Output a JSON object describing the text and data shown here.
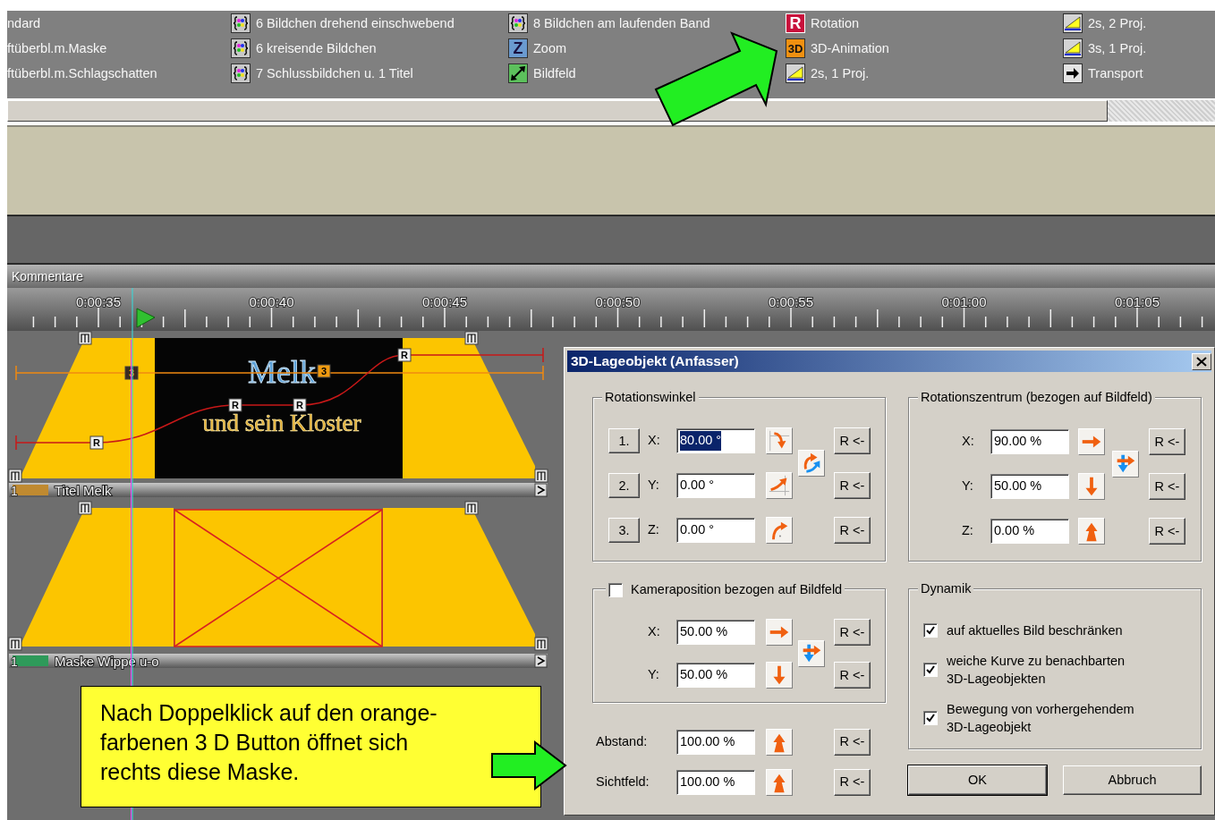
{
  "effects_panel": {
    "columns": [
      [
        {
          "label": "ndard",
          "kind": "none"
        },
        {
          "label": "ftüberbl.m.Maske",
          "kind": "none"
        },
        {
          "label": "ftüberbl.m.Schlagschatten",
          "kind": "none"
        }
      ],
      [
        {
          "label": "6 Bildchen drehend einschwebend",
          "kind": "star"
        },
        {
          "label": "6 kreisende Bildchen",
          "kind": "star"
        },
        {
          "label": "7 Schlussbildchen u. 1 Titel",
          "kind": "star"
        }
      ],
      [
        {
          "label": "8 Bildchen am laufenden Band",
          "kind": "star"
        },
        {
          "label": "Zoom",
          "kind": "zoom",
          "icon_text": "Z"
        },
        {
          "label": "Bildfeld",
          "kind": "field"
        }
      ],
      [
        {
          "label": "Rotation",
          "kind": "rotation",
          "icon_text": "R"
        },
        {
          "label": "3D-Animation",
          "kind": "animation",
          "icon_text": "3D"
        },
        {
          "label": "2s, 1 Proj.",
          "kind": "ramp"
        }
      ],
      [
        {
          "label": "2s, 2 Proj.",
          "kind": "ramp"
        },
        {
          "label": "3s, 1 Proj.",
          "kind": "ramp"
        },
        {
          "label": "Transport",
          "kind": "transport"
        }
      ]
    ]
  },
  "timeline": {
    "comments_label": "Kommentare",
    "time_labels": [
      "0:00:35",
      "0:00:40",
      "0:00:45",
      "0:00:50",
      "0:00:55",
      "0:01:00",
      "0:01:05"
    ],
    "tracks": [
      {
        "kind": "title",
        "number": "1",
        "name": "Titel Melk",
        "color": "#c08a30",
        "preview": {
          "line_1": "Melk",
          "line_2": "und sein Kloster"
        },
        "keyframes": [
          {
            "kind": "position",
            "label": "3",
            "selected": true
          },
          {
            "kind": "position",
            "label": "3",
            "selected": false
          },
          {
            "kind": "rotation",
            "label": "R",
            "selected": false
          },
          {
            "kind": "rotation",
            "label": "R",
            "selected": false
          },
          {
            "kind": "rotation",
            "label": "R",
            "selected": false
          },
          {
            "kind": "rotation",
            "label": "R",
            "selected": false
          }
        ]
      },
      {
        "kind": "mask",
        "number": "1",
        "name": "Maske Wippe u-o",
        "color": "#2e9a5a"
      }
    ]
  },
  "dialog": {
    "title": "3D-Lageobjekt (Anfasser)",
    "rotation": {
      "legend": "Rotationswinkel",
      "rows": [
        {
          "button": "1.",
          "axis": "X:",
          "value": "80.00 °",
          "text_selected": true,
          "reset": "R <-"
        },
        {
          "button": "2.",
          "axis": "Y:",
          "value": "0.00 °",
          "text_selected": false,
          "reset": "R <-"
        },
        {
          "button": "3.",
          "axis": "Z:",
          "value": "0.00 °",
          "text_selected": false,
          "reset": "R <-"
        }
      ]
    },
    "center": {
      "legend": "Rotationszentrum (bezogen auf Bildfeld)",
      "rows": [
        {
          "axis": "X:",
          "value": "90.00 %",
          "reset": "R <-"
        },
        {
          "axis": "Y:",
          "value": "50.00 %",
          "reset": "R <-"
        },
        {
          "axis": "Z:",
          "value": "0.00 %",
          "reset": "R <-"
        }
      ]
    },
    "camera": {
      "label": "Kameraposition bezogen auf Bildfeld",
      "checked": false,
      "rows": [
        {
          "axis": "X:",
          "value": "50.00 %",
          "reset": "R <-"
        },
        {
          "axis": "Y:",
          "value": "50.00 %",
          "reset": "R <-"
        }
      ]
    },
    "distance_rows": [
      {
        "label": "Abstand:",
        "value": "100.00 %",
        "reset": "R <-"
      },
      {
        "label": "Sichtfeld:",
        "value": "100.00 %",
        "reset": "R <-"
      }
    ],
    "dynamics": {
      "legend": "Dynamik",
      "options": [
        {
          "label": "auf aktuelles Bild beschränken",
          "checked": true
        },
        {
          "label": "weiche Kurve zu benachbarten\n3D-Lageobjekten",
          "checked": true
        },
        {
          "label": "Bewegung von vorhergehendem\n3D-Lageobjekt",
          "checked": true
        }
      ]
    },
    "buttons": [
      {
        "label": "OK",
        "default": true
      },
      {
        "label": "Abbruch",
        "default": false
      }
    ]
  },
  "callout": {
    "text": "Nach Doppelklick auf den orange-\nfarbenen 3 D Button öffnet sich\nrechts diese Maske."
  }
}
